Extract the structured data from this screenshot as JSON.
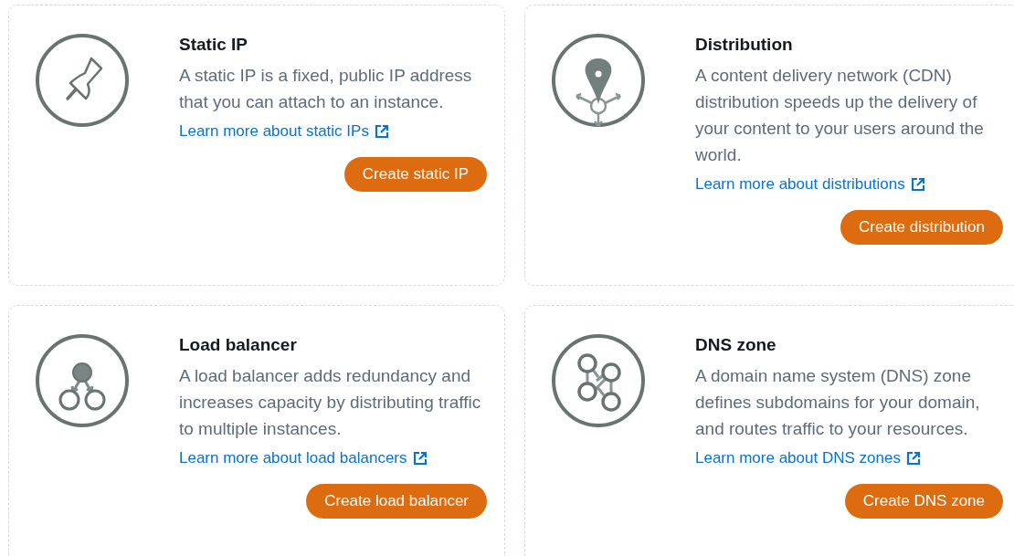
{
  "cards": [
    {
      "kind": "pushpin",
      "title": "Static IP",
      "description": "A static IP is a fixed, public IP address that you can attach to an instance.",
      "link": "Learn more about static IPs",
      "button": "Create static IP"
    },
    {
      "kind": "location",
      "title": "Distribution",
      "description": "A content delivery network (CDN) distribution speeds up the delivery of your content to your users around the world.",
      "link": "Learn more about distributions",
      "button": "Create distribution"
    },
    {
      "kind": "balancer",
      "title": "Load balancer",
      "description": "A load balancer adds redundancy and increases capacity by distributing traffic to multiple instances.",
      "link": "Learn more about load balancers",
      "button": "Create load balancer"
    },
    {
      "kind": "network",
      "title": "DNS zone",
      "description": "A domain name system (DNS) zone defines subdomains for your domain, and routes traffic to your resources.",
      "link": "Learn more about DNS zones",
      "button": "Create DNS zone"
    }
  ]
}
